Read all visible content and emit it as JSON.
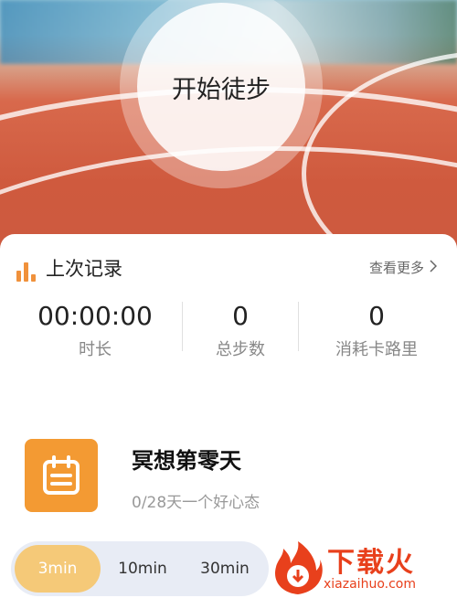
{
  "start": {
    "label": "开始徒步"
  },
  "last_record": {
    "title": "上次记录",
    "more_label": "查看更多",
    "stats": [
      {
        "value": "00:00:00",
        "label": "时长"
      },
      {
        "value": "0",
        "label": "总步数"
      },
      {
        "value": "0",
        "label": "消耗卡路里"
      }
    ]
  },
  "plan": {
    "title": "冥想第零天",
    "subtitle": "0/28天一个好心态",
    "icon": "calendar-icon"
  },
  "durations": {
    "options": [
      "3min",
      "10min",
      "30min"
    ],
    "selected": "3min"
  },
  "watermark": {
    "text": "下载火",
    "url": "xiazaihuo.com"
  },
  "colors": {
    "accent": "#f39a33",
    "selected": "#f5c978",
    "watermark": "#e8401c"
  }
}
